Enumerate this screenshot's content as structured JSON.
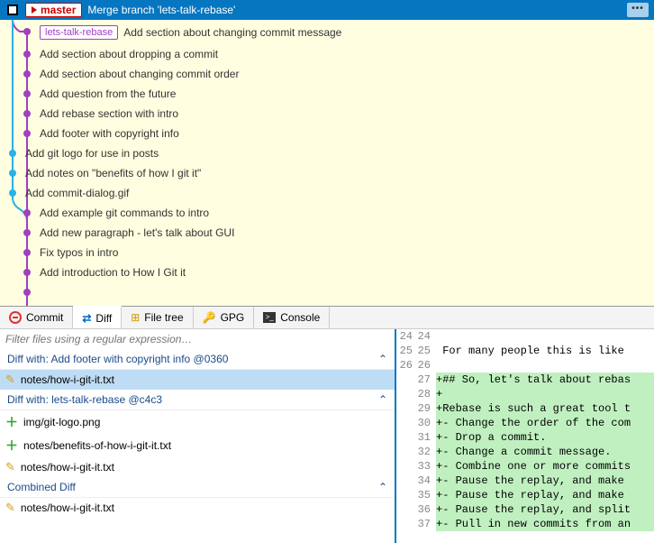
{
  "topbar": {
    "branch": "master",
    "merge_message": "Merge branch 'lets-talk-rebase'",
    "dots": "•••"
  },
  "commits": [
    {
      "branch_label": "lets-talk-rebase",
      "message": "Add section about changing commit message"
    },
    {
      "message": "Add section about dropping a commit"
    },
    {
      "message": "Add section about changing commit order"
    },
    {
      "message": "Add question from the future"
    },
    {
      "message": "Add rebase section with intro"
    },
    {
      "message": "Add footer with copyright info"
    },
    {
      "message": "Add git logo for use in posts"
    },
    {
      "message": "Add notes on \"benefits of how I git it\""
    },
    {
      "message": "Add commit-dialog.gif"
    },
    {
      "message": "Add example git commands to intro"
    },
    {
      "message": "Add new paragraph - let's talk about GUI"
    },
    {
      "message": "Fix typos in intro"
    },
    {
      "message": "Add introduction to How I Git it"
    }
  ],
  "tabs": {
    "commit": "Commit",
    "diff": "Diff",
    "filetree": "File tree",
    "gpg": "GPG",
    "console": "Console"
  },
  "filter_placeholder": "Filter files using a regular expression…",
  "sections": {
    "diff1": {
      "title": "Diff with: Add footer with copyright info @0360",
      "files": [
        "notes/how-i-git-it.txt"
      ]
    },
    "diff2": {
      "title": "Diff with: lets-talk-rebase @c4c3",
      "files": [
        "img/git-logo.png",
        "notes/benefits-of-how-i-git-it.txt",
        "notes/how-i-git-it.txt"
      ]
    },
    "combined": {
      "title": "Combined Diff",
      "files": [
        "notes/how-i-git-it.txt"
      ]
    }
  },
  "chart_data": {
    "type": "table",
    "title": "diff view",
    "lines": [
      {
        "l": "24",
        "r": "24",
        "t": "",
        "add": false
      },
      {
        "l": "25",
        "r": "25",
        "t": " For many people this is like",
        "add": false
      },
      {
        "l": "26",
        "r": "26",
        "t": "",
        "add": false
      },
      {
        "l": "",
        "r": "27",
        "t": "+## So, let's talk about rebas",
        "add": true
      },
      {
        "l": "",
        "r": "28",
        "t": "+",
        "add": true
      },
      {
        "l": "",
        "r": "29",
        "t": "+Rebase is such a great tool t",
        "add": true
      },
      {
        "l": "",
        "r": "30",
        "t": "+- Change the order of the com",
        "add": true
      },
      {
        "l": "",
        "r": "31",
        "t": "+- Drop a commit.",
        "add": true
      },
      {
        "l": "",
        "r": "32",
        "t": "+- Change a commit message.",
        "add": true
      },
      {
        "l": "",
        "r": "33",
        "t": "+- Combine one or more commits",
        "add": true
      },
      {
        "l": "",
        "r": "34",
        "t": "+- Pause the replay, and make ",
        "add": true
      },
      {
        "l": "",
        "r": "35",
        "t": "+- Pause the replay, and make ",
        "add": true
      },
      {
        "l": "",
        "r": "36",
        "t": "+- Pause the replay, and split",
        "add": true
      },
      {
        "l": "",
        "r": "37",
        "t": "+- Pull in new commits from an",
        "add": true
      }
    ]
  }
}
